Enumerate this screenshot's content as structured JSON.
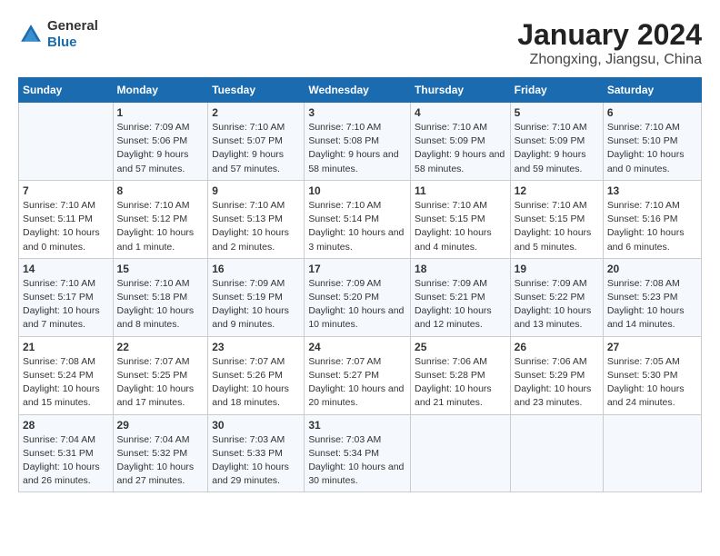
{
  "logo": {
    "text_general": "General",
    "text_blue": "Blue"
  },
  "title": "January 2024",
  "subtitle": "Zhongxing, Jiangsu, China",
  "headers": [
    "Sunday",
    "Monday",
    "Tuesday",
    "Wednesday",
    "Thursday",
    "Friday",
    "Saturday"
  ],
  "weeks": [
    [
      {
        "day": "",
        "sunrise": "",
        "sunset": "",
        "daylight": ""
      },
      {
        "day": "1",
        "sunrise": "Sunrise: 7:09 AM",
        "sunset": "Sunset: 5:06 PM",
        "daylight": "Daylight: 9 hours and 57 minutes."
      },
      {
        "day": "2",
        "sunrise": "Sunrise: 7:10 AM",
        "sunset": "Sunset: 5:07 PM",
        "daylight": "Daylight: 9 hours and 57 minutes."
      },
      {
        "day": "3",
        "sunrise": "Sunrise: 7:10 AM",
        "sunset": "Sunset: 5:08 PM",
        "daylight": "Daylight: 9 hours and 58 minutes."
      },
      {
        "day": "4",
        "sunrise": "Sunrise: 7:10 AM",
        "sunset": "Sunset: 5:09 PM",
        "daylight": "Daylight: 9 hours and 58 minutes."
      },
      {
        "day": "5",
        "sunrise": "Sunrise: 7:10 AM",
        "sunset": "Sunset: 5:09 PM",
        "daylight": "Daylight: 9 hours and 59 minutes."
      },
      {
        "day": "6",
        "sunrise": "Sunrise: 7:10 AM",
        "sunset": "Sunset: 5:10 PM",
        "daylight": "Daylight: 10 hours and 0 minutes."
      }
    ],
    [
      {
        "day": "7",
        "sunrise": "Sunrise: 7:10 AM",
        "sunset": "Sunset: 5:11 PM",
        "daylight": "Daylight: 10 hours and 0 minutes."
      },
      {
        "day": "8",
        "sunrise": "Sunrise: 7:10 AM",
        "sunset": "Sunset: 5:12 PM",
        "daylight": "Daylight: 10 hours and 1 minute."
      },
      {
        "day": "9",
        "sunrise": "Sunrise: 7:10 AM",
        "sunset": "Sunset: 5:13 PM",
        "daylight": "Daylight: 10 hours and 2 minutes."
      },
      {
        "day": "10",
        "sunrise": "Sunrise: 7:10 AM",
        "sunset": "Sunset: 5:14 PM",
        "daylight": "Daylight: 10 hours and 3 minutes."
      },
      {
        "day": "11",
        "sunrise": "Sunrise: 7:10 AM",
        "sunset": "Sunset: 5:15 PM",
        "daylight": "Daylight: 10 hours and 4 minutes."
      },
      {
        "day": "12",
        "sunrise": "Sunrise: 7:10 AM",
        "sunset": "Sunset: 5:15 PM",
        "daylight": "Daylight: 10 hours and 5 minutes."
      },
      {
        "day": "13",
        "sunrise": "Sunrise: 7:10 AM",
        "sunset": "Sunset: 5:16 PM",
        "daylight": "Daylight: 10 hours and 6 minutes."
      }
    ],
    [
      {
        "day": "14",
        "sunrise": "Sunrise: 7:10 AM",
        "sunset": "Sunset: 5:17 PM",
        "daylight": "Daylight: 10 hours and 7 minutes."
      },
      {
        "day": "15",
        "sunrise": "Sunrise: 7:10 AM",
        "sunset": "Sunset: 5:18 PM",
        "daylight": "Daylight: 10 hours and 8 minutes."
      },
      {
        "day": "16",
        "sunrise": "Sunrise: 7:09 AM",
        "sunset": "Sunset: 5:19 PM",
        "daylight": "Daylight: 10 hours and 9 minutes."
      },
      {
        "day": "17",
        "sunrise": "Sunrise: 7:09 AM",
        "sunset": "Sunset: 5:20 PM",
        "daylight": "Daylight: 10 hours and 10 minutes."
      },
      {
        "day": "18",
        "sunrise": "Sunrise: 7:09 AM",
        "sunset": "Sunset: 5:21 PM",
        "daylight": "Daylight: 10 hours and 12 minutes."
      },
      {
        "day": "19",
        "sunrise": "Sunrise: 7:09 AM",
        "sunset": "Sunset: 5:22 PM",
        "daylight": "Daylight: 10 hours and 13 minutes."
      },
      {
        "day": "20",
        "sunrise": "Sunrise: 7:08 AM",
        "sunset": "Sunset: 5:23 PM",
        "daylight": "Daylight: 10 hours and 14 minutes."
      }
    ],
    [
      {
        "day": "21",
        "sunrise": "Sunrise: 7:08 AM",
        "sunset": "Sunset: 5:24 PM",
        "daylight": "Daylight: 10 hours and 15 minutes."
      },
      {
        "day": "22",
        "sunrise": "Sunrise: 7:07 AM",
        "sunset": "Sunset: 5:25 PM",
        "daylight": "Daylight: 10 hours and 17 minutes."
      },
      {
        "day": "23",
        "sunrise": "Sunrise: 7:07 AM",
        "sunset": "Sunset: 5:26 PM",
        "daylight": "Daylight: 10 hours and 18 minutes."
      },
      {
        "day": "24",
        "sunrise": "Sunrise: 7:07 AM",
        "sunset": "Sunset: 5:27 PM",
        "daylight": "Daylight: 10 hours and 20 minutes."
      },
      {
        "day": "25",
        "sunrise": "Sunrise: 7:06 AM",
        "sunset": "Sunset: 5:28 PM",
        "daylight": "Daylight: 10 hours and 21 minutes."
      },
      {
        "day": "26",
        "sunrise": "Sunrise: 7:06 AM",
        "sunset": "Sunset: 5:29 PM",
        "daylight": "Daylight: 10 hours and 23 minutes."
      },
      {
        "day": "27",
        "sunrise": "Sunrise: 7:05 AM",
        "sunset": "Sunset: 5:30 PM",
        "daylight": "Daylight: 10 hours and 24 minutes."
      }
    ],
    [
      {
        "day": "28",
        "sunrise": "Sunrise: 7:04 AM",
        "sunset": "Sunset: 5:31 PM",
        "daylight": "Daylight: 10 hours and 26 minutes."
      },
      {
        "day": "29",
        "sunrise": "Sunrise: 7:04 AM",
        "sunset": "Sunset: 5:32 PM",
        "daylight": "Daylight: 10 hours and 27 minutes."
      },
      {
        "day": "30",
        "sunrise": "Sunrise: 7:03 AM",
        "sunset": "Sunset: 5:33 PM",
        "daylight": "Daylight: 10 hours and 29 minutes."
      },
      {
        "day": "31",
        "sunrise": "Sunrise: 7:03 AM",
        "sunset": "Sunset: 5:34 PM",
        "daylight": "Daylight: 10 hours and 30 minutes."
      },
      {
        "day": "",
        "sunrise": "",
        "sunset": "",
        "daylight": ""
      },
      {
        "day": "",
        "sunrise": "",
        "sunset": "",
        "daylight": ""
      },
      {
        "day": "",
        "sunrise": "",
        "sunset": "",
        "daylight": ""
      }
    ]
  ]
}
